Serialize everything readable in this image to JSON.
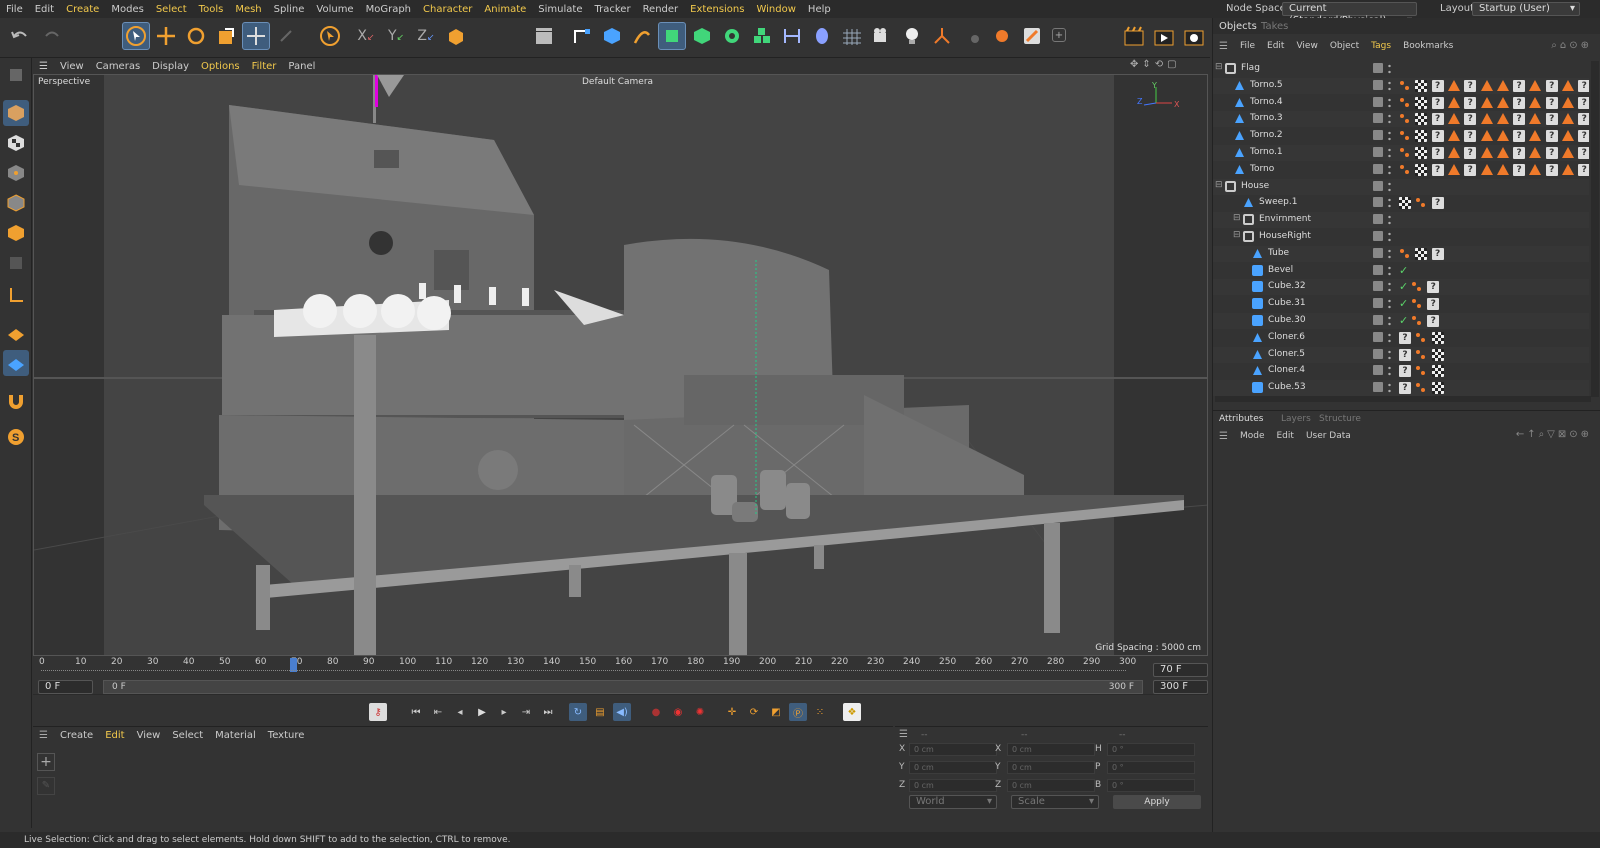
{
  "menubar": {
    "items": [
      "File",
      "Edit",
      "Create",
      "Modes",
      "Select",
      "Tools",
      "Mesh",
      "Spline",
      "Volume",
      "MoGraph",
      "Character",
      "Animate",
      "Simulate",
      "Tracker",
      "Render",
      "Extensions",
      "Window",
      "Help"
    ],
    "highlighted": [
      "Create",
      "Select",
      "Tools",
      "Mesh",
      "Character",
      "Animate",
      "Extensions",
      "Window"
    ],
    "node_space_label": "Node Space:",
    "node_space_value": "Current (Standard/Physical)",
    "layout_label": "Layout:",
    "layout_value": "Startup (User)"
  },
  "viewport": {
    "menu": [
      "View",
      "Cameras",
      "Display",
      "Options",
      "Filter",
      "Panel"
    ],
    "highlighted": [
      "Options",
      "Filter"
    ],
    "label": "Perspective",
    "camera": "Default Camera",
    "grid_spacing": "Grid Spacing : 5000 cm",
    "axes": {
      "x": "X",
      "y": "Y",
      "z": "Z"
    }
  },
  "timeline": {
    "ticks": [
      "0",
      "10",
      "20",
      "30",
      "40",
      "50",
      "60",
      "70",
      "80",
      "90",
      "100",
      "110",
      "120",
      "130",
      "140",
      "150",
      "160",
      "170",
      "180",
      "190",
      "200",
      "210",
      "220",
      "230",
      "240",
      "250",
      "260",
      "270",
      "280",
      "290",
      "300"
    ],
    "current_frame": "70 F",
    "current_frame_position": 0.2333,
    "start_field": "0 F",
    "range_start": "0 F",
    "range_end": "300 F",
    "end_field": "300 F"
  },
  "material_manager": {
    "menu": [
      "Create",
      "Edit",
      "View",
      "Select",
      "Material",
      "Texture"
    ],
    "highlighted": [
      "Edit"
    ]
  },
  "coordinates": {
    "headers": [
      "--",
      "--",
      "--"
    ],
    "rows": [
      {
        "l1": "X",
        "v1": "0 cm",
        "l2": "X",
        "v2": "0 cm",
        "l3": "H",
        "v3": "0 °"
      },
      {
        "l1": "Y",
        "v1": "0 cm",
        "l2": "Y",
        "v2": "0 cm",
        "l3": "P",
        "v3": "0 °"
      },
      {
        "l1": "Z",
        "v1": "0 cm",
        "l2": "Z",
        "v2": "0 cm",
        "l3": "B",
        "v3": "0 °"
      }
    ],
    "space": "World",
    "mode": "Scale",
    "apply": "Apply"
  },
  "objects_panel": {
    "tabs": [
      "Objects",
      "Takes"
    ],
    "menu": [
      "File",
      "Edit",
      "View",
      "Object",
      "Tags",
      "Bookmarks"
    ],
    "highlighted": [
      "Tags"
    ],
    "rows": [
      {
        "name": "Flag",
        "depth": 0,
        "icon": "null",
        "tags": []
      },
      {
        "name": "Torno.5",
        "depth": 1,
        "icon": "lathe",
        "tags": [
          "pt",
          "chk",
          "q",
          "tri",
          "q",
          "tri",
          "tri",
          "q",
          "tri",
          "q",
          "tri",
          "q"
        ]
      },
      {
        "name": "Torno.4",
        "depth": 1,
        "icon": "lathe",
        "tags": [
          "pt",
          "chk",
          "q",
          "tri",
          "q",
          "tri",
          "tri",
          "q",
          "tri",
          "q",
          "tri",
          "q"
        ]
      },
      {
        "name": "Torno.3",
        "depth": 1,
        "icon": "lathe",
        "tags": [
          "pt",
          "chk",
          "q",
          "tri",
          "q",
          "tri",
          "tri",
          "q",
          "tri",
          "q",
          "tri",
          "q"
        ]
      },
      {
        "name": "Torno.2",
        "depth": 1,
        "icon": "lathe",
        "tags": [
          "pt",
          "chk",
          "q",
          "tri",
          "q",
          "tri",
          "tri",
          "q",
          "tri",
          "q",
          "tri",
          "q"
        ]
      },
      {
        "name": "Torno.1",
        "depth": 1,
        "icon": "lathe",
        "tags": [
          "pt",
          "chk",
          "q",
          "tri",
          "q",
          "tri",
          "tri",
          "q",
          "tri",
          "q",
          "tri",
          "q"
        ]
      },
      {
        "name": "Torno",
        "depth": 1,
        "icon": "lathe",
        "tags": [
          "pt",
          "chk",
          "q",
          "tri",
          "q",
          "tri",
          "tri",
          "q",
          "tri",
          "q",
          "tri",
          "q"
        ]
      },
      {
        "name": "House",
        "depth": 0,
        "icon": "null",
        "tags": []
      },
      {
        "name": "Sweep.1",
        "depth": 2,
        "icon": "lathe",
        "tags": [
          "chk",
          "pt",
          "q"
        ]
      },
      {
        "name": "Envirnment",
        "depth": 2,
        "icon": "null",
        "tags": []
      },
      {
        "name": "HouseRight",
        "depth": 2,
        "icon": "null",
        "tags": []
      },
      {
        "name": "Tube",
        "depth": 3,
        "icon": "lathe",
        "tags": [
          "pt",
          "chk",
          "q"
        ]
      },
      {
        "name": "Bevel",
        "depth": 3,
        "icon": "cube",
        "tags": []
      },
      {
        "name": "Cube.32",
        "depth": 3,
        "icon": "cube",
        "tags": [
          "pt",
          "q"
        ]
      },
      {
        "name": "Cube.31",
        "depth": 3,
        "icon": "cube",
        "tags": [
          "pt",
          "q"
        ]
      },
      {
        "name": "Cube.30",
        "depth": 3,
        "icon": "cube",
        "tags": [
          "pt",
          "q"
        ]
      },
      {
        "name": "Cloner.6",
        "depth": 3,
        "icon": "lathe",
        "tags": [
          "q",
          "pt",
          "chk"
        ]
      },
      {
        "name": "Cloner.5",
        "depth": 3,
        "icon": "lathe",
        "tags": [
          "q",
          "pt",
          "chk"
        ]
      },
      {
        "name": "Cloner.4",
        "depth": 3,
        "icon": "lathe",
        "tags": [
          "q",
          "pt",
          "chk"
        ]
      },
      {
        "name": "Cube.53",
        "depth": 3,
        "icon": "cube",
        "tags": [
          "q",
          "pt",
          "chk"
        ]
      }
    ]
  },
  "attributes_panel": {
    "tabs": [
      "Attributes",
      "Layers",
      "Structure"
    ],
    "menu": [
      "Mode",
      "Edit",
      "User Data"
    ]
  },
  "status": "Live Selection: Click and drag to select elements. Hold down SHIFT to add to the selection, CTRL to remove.",
  "colors": {
    "accent": "#f2c94c",
    "selection": "#3f5d7d",
    "orange": "#f07a2a"
  }
}
